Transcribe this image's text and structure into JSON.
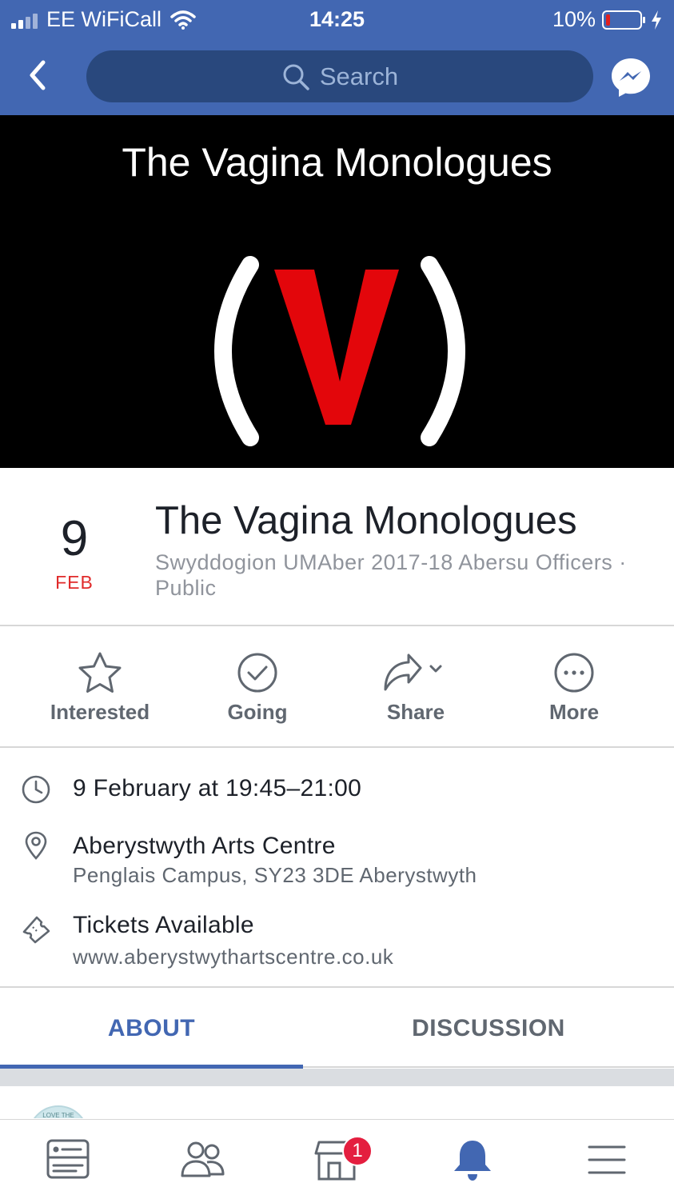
{
  "status_bar": {
    "carrier": "EE WiFiCall",
    "time": "14:25",
    "battery": "10%"
  },
  "header": {
    "search_placeholder": "Search",
    "brand_color": "#4267b2"
  },
  "cover": {
    "title": "The Vagina Monologues",
    "logo_text": "(V)"
  },
  "event": {
    "day": "9",
    "month": "FEB",
    "title": "The Vagina Monologues",
    "host_line": "Swyddogion UMAber 2017-18 Abersu Officers · Public"
  },
  "actions": [
    {
      "label": "Interested",
      "icon": "star-icon"
    },
    {
      "label": "Going",
      "icon": "check-circle-icon"
    },
    {
      "label": "Share",
      "icon": "share-icon"
    },
    {
      "label": "More",
      "icon": "more-icon"
    }
  ],
  "details": {
    "time": "9 February at 19:45–21:00",
    "location_name": "Aberystwyth Arts Centre",
    "location_address": "Penglais Campus, SY23 3DE Aberystwyth",
    "tickets_label": "Tickets Available",
    "tickets_url": "www.aberystwythartscentre.co.uk"
  },
  "tabs": {
    "about": "ABOUT",
    "discussion": "DISCUSSION",
    "active": "about"
  },
  "feed_peek": {
    "avatar_text": "LOVE THE"
  },
  "bottom_nav": {
    "items": [
      "news-feed-icon",
      "friends-icon",
      "marketplace-icon",
      "notifications-icon",
      "menu-icon"
    ],
    "marketplace_badge": "1",
    "active": "notifications-icon"
  }
}
